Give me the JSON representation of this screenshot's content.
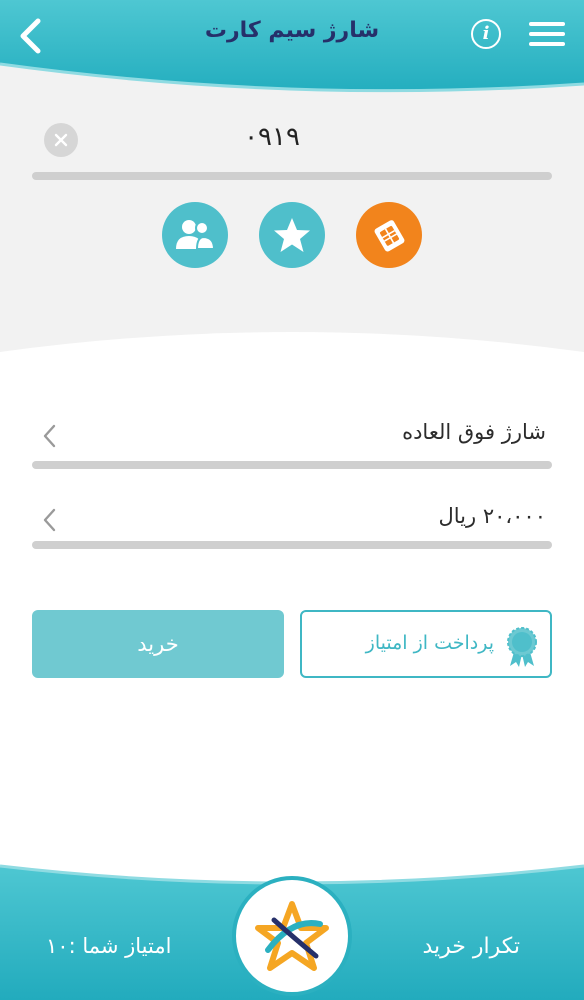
{
  "header": {
    "title": "شارژ سیم کارت",
    "info_label": "i"
  },
  "phone": {
    "value": "۰۹۱۹"
  },
  "icons": {
    "contacts": "contacts-icon",
    "favorites": "star-icon",
    "sim": "sim-card-icon"
  },
  "form": {
    "charge_type": "شارژ فوق العاده",
    "amount": "۲۰،۰۰۰ ریال"
  },
  "buttons": {
    "buy": "خرید",
    "pay_with_points": "پرداخت از امتیاز"
  },
  "footer": {
    "repeat_purchase": "تکرار خرید",
    "score": "امتیاز شما :۱۰"
  },
  "colors": {
    "accent": "#2bb0c0",
    "accent_light": "#70c9d1",
    "orange": "#f2841c",
    "title": "#26306a"
  }
}
